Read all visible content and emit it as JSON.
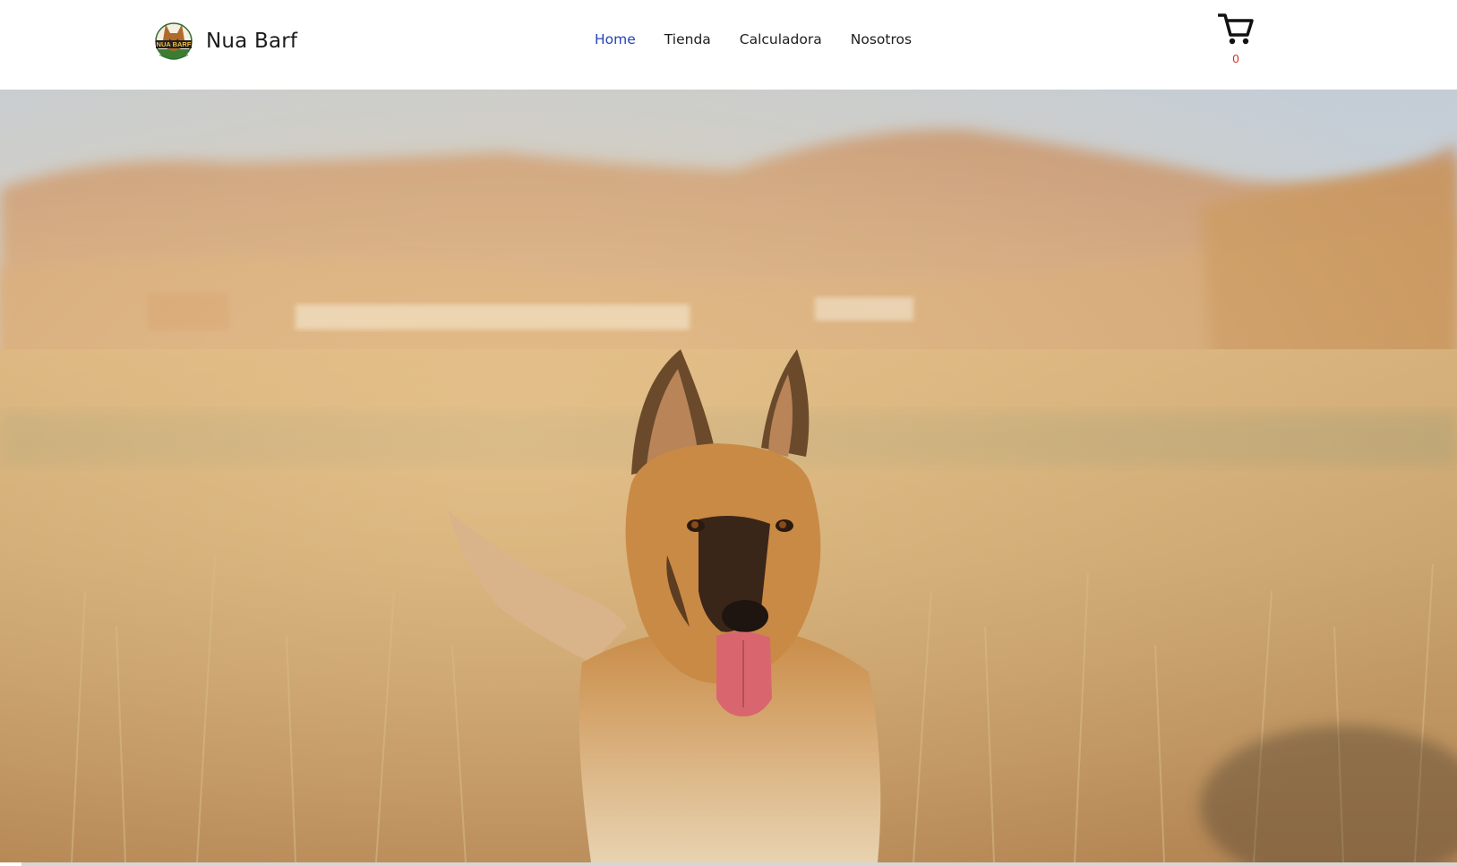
{
  "brand": {
    "name": "Nua Barf",
    "logo_text": "NUA BARF"
  },
  "nav": {
    "items": [
      {
        "label": "Home",
        "active": true
      },
      {
        "label": "Tienda",
        "active": false
      },
      {
        "label": "Calculadora",
        "active": false
      },
      {
        "label": "Nosotros",
        "active": false
      }
    ]
  },
  "cart": {
    "icon": "cart-icon",
    "count": "0"
  },
  "hero": {
    "image": "german-shepherd-dog-running-in-dry-grass-field-photo"
  },
  "colors": {
    "accent": "#2444b8",
    "text": "#1d1d1d",
    "cart_count": "#e02020",
    "background": "#ffffff"
  }
}
